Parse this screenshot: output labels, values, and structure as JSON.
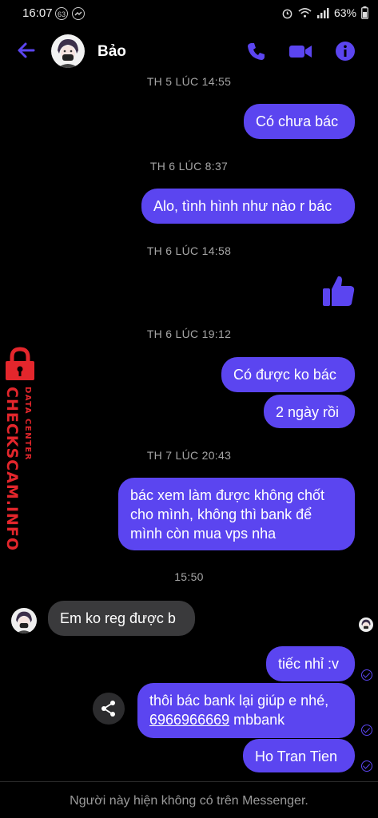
{
  "status_bar": {
    "time": "16:07",
    "notif_count": "63",
    "battery": "63%"
  },
  "header": {
    "contact_name": "Bảo"
  },
  "thread": {
    "timestamps": [
      "TH 5 LÚC 14:55",
      "TH 6 LÚC 8:37",
      "TH 6 LÚC 14:58",
      "TH 6 LÚC 19:12",
      "TH 7 LÚC 20:43",
      "15:50"
    ],
    "messages": {
      "m1": "Có chưa bác",
      "m2": "Alo, tình hình như nào r bác",
      "m3": "Có được ko bác",
      "m4": "2 ngày rồi",
      "m5": "bác xem làm được không chốt cho mình, không thì bank để mình còn mua vps nha",
      "m6_incoming": "Em ko reg được b",
      "m7": "tiếc nhỉ :v",
      "m8_line1": "thôi bác bank lại giúp e nhé,",
      "m8_account": "6966966669",
      "m8_bank": " mbbank",
      "m9": "Ho Tran Tien"
    },
    "like_icon": "thumbs-up"
  },
  "footer": {
    "text": "Người này hiện không có trên Messenger."
  },
  "watermark": {
    "main": "CHECKSCAM.INFO",
    "sub": "DATA CENTER"
  },
  "colors": {
    "accent": "#5b45f0",
    "incoming_bubble": "#3a3a3c",
    "watermark": "#e3262c"
  }
}
